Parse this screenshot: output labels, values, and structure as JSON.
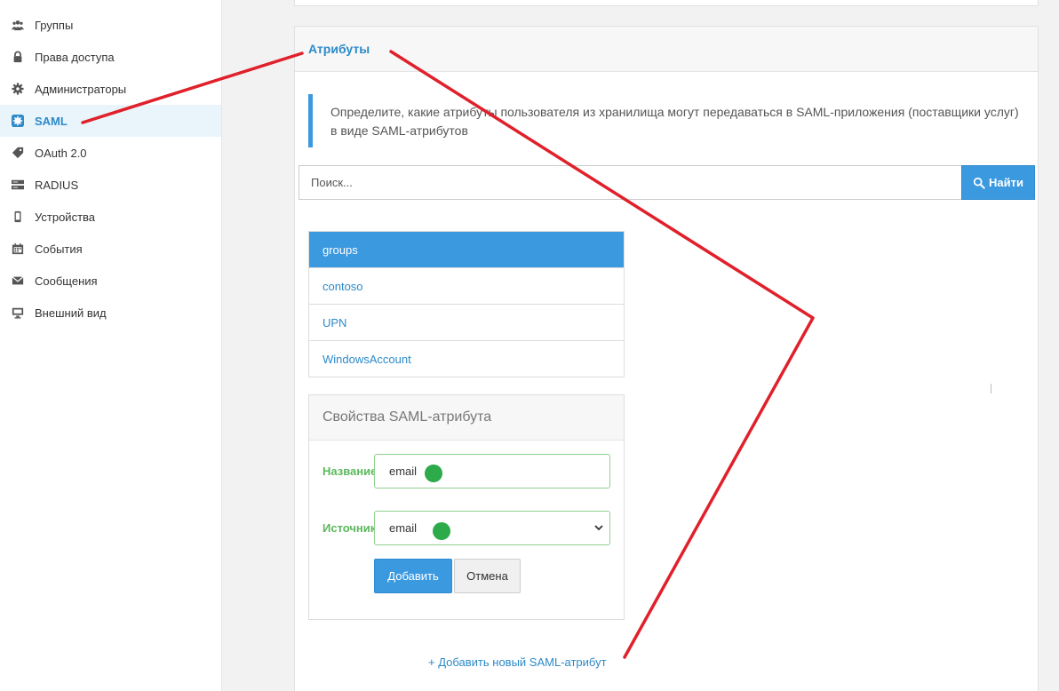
{
  "sidebar": {
    "items": [
      {
        "label": "Группы",
        "icon": "users-icon",
        "active": false
      },
      {
        "label": "Права доступа",
        "icon": "lock-icon",
        "active": false
      },
      {
        "label": "Администраторы",
        "icon": "gear-icon",
        "active": false
      },
      {
        "label": "SAML",
        "icon": "saml-badge-icon",
        "active": true
      },
      {
        "label": "OAuth 2.0",
        "icon": "tag-icon",
        "active": false
      },
      {
        "label": "RADIUS",
        "icon": "server-icon",
        "active": false
      },
      {
        "label": "Устройства",
        "icon": "mobile-icon",
        "active": false
      },
      {
        "label": "События",
        "icon": "calendar-icon",
        "active": false
      },
      {
        "label": "Сообщения",
        "icon": "envelope-icon",
        "active": false
      },
      {
        "label": "Внешний вид",
        "icon": "monitor-icon",
        "active": false
      }
    ]
  },
  "panel": {
    "title": "Атрибуты",
    "description": "Определите, какие атрибуты пользователя из хранилища могут передаваться в SAML-приложения (поставщики услуг) в виде SAML-атрибутов"
  },
  "search": {
    "placeholder": "Поиск...",
    "button_label": "Найти"
  },
  "attributes": [
    "groups",
    "contoso",
    "UPN",
    "WindowsAccount"
  ],
  "properties": {
    "title": "Свойства SAML-атрибута",
    "name_label": "Название",
    "name_value": "email",
    "source_label": "Источник",
    "source_value": "email",
    "add_button": "Добавить",
    "cancel_button": "Отмена"
  },
  "add_link": "+ Добавить новый SAML-атрибут",
  "colors": {
    "accent": "#3b99e0",
    "link": "#2c8ac9",
    "success": "#5cb85c",
    "annotation": "#e0202a",
    "marker": "#2daa4a"
  }
}
